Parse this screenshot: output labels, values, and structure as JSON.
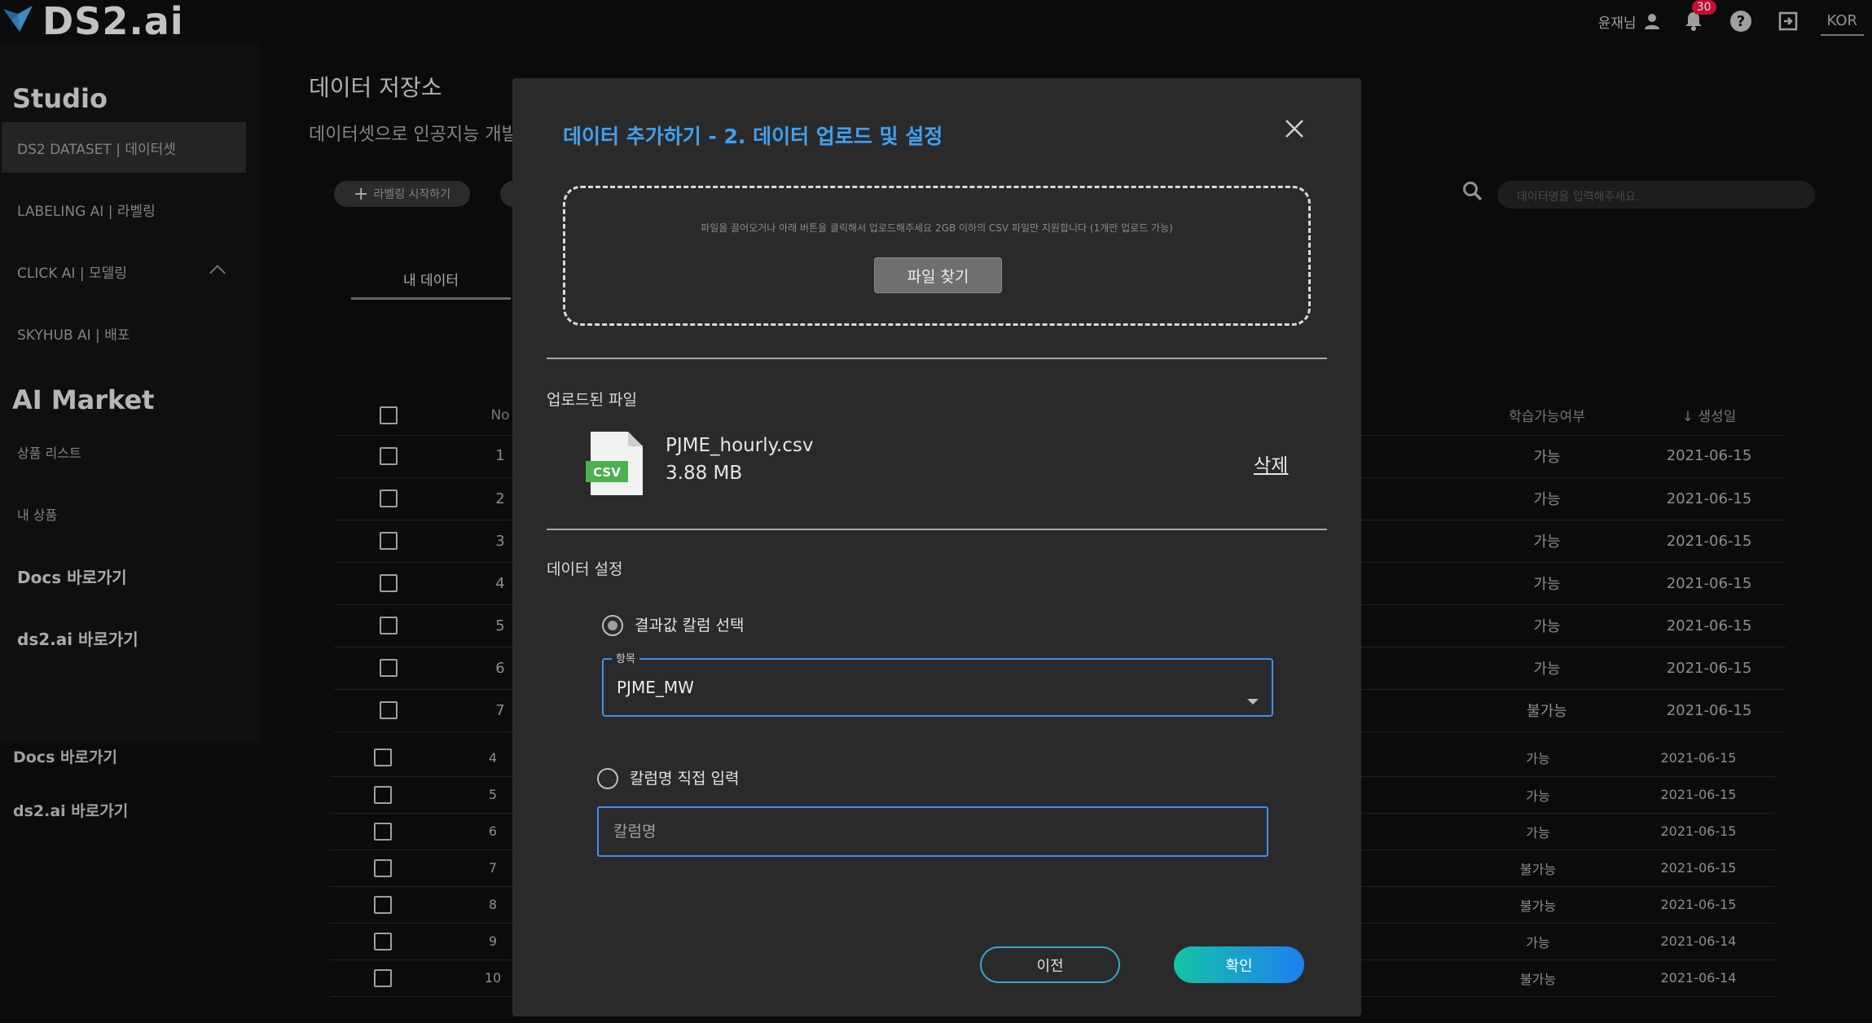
{
  "app": {
    "logo_text": "DS2.ai"
  },
  "topbar": {
    "user_name": "윤재님",
    "notification_count": "30",
    "language": "KOR"
  },
  "sidebar": {
    "studio_title": "Studio",
    "items": [
      {
        "label": "DS2 DATASET | 데이터셋"
      },
      {
        "label": "LABELING AI | 라벨링"
      },
      {
        "label": "CLICK AI | 모델링"
      },
      {
        "label": "SKYHUB AI | 배포"
      }
    ],
    "market_title": "AI Market",
    "market_items": [
      {
        "label": "상품 리스트"
      },
      {
        "label": "내 상품"
      }
    ],
    "links": [
      {
        "label": "Docs 바로가기"
      },
      {
        "label": "ds2.ai 바로가기"
      }
    ],
    "bottom_links": [
      {
        "label": "Docs 바로가기"
      },
      {
        "label": "ds2.ai 바로가기"
      }
    ]
  },
  "page": {
    "title": "데이터 저장소",
    "description": "데이터셋으로 인공지능 개발",
    "start_labeling_button": "라벨링 시작하기",
    "tab_my_data": "내 데이터",
    "search_placeholder": "데이터명을 입력해주세요."
  },
  "table": {
    "headers": {
      "no": "No",
      "trainable": "학습가능여부",
      "created": "생성일"
    },
    "rows_top": [
      {
        "no": "1",
        "trainable": "가능",
        "created": "2021-06-15"
      },
      {
        "no": "2",
        "trainable": "가능",
        "created": "2021-06-15"
      },
      {
        "no": "3",
        "trainable": "가능",
        "created": "2021-06-15"
      },
      {
        "no": "4",
        "trainable": "가능",
        "created": "2021-06-15"
      },
      {
        "no": "5",
        "trainable": "가능",
        "created": "2021-06-15"
      },
      {
        "no": "6",
        "trainable": "가능",
        "created": "2021-06-15"
      },
      {
        "no": "7",
        "trainable": "불가능",
        "created": "2021-06-15"
      }
    ],
    "rows_bottom": [
      {
        "no": "4",
        "trainable": "가능",
        "created": "2021-06-15"
      },
      {
        "no": "5",
        "trainable": "가능",
        "created": "2021-06-15"
      },
      {
        "no": "6",
        "trainable": "가능",
        "created": "2021-06-15"
      },
      {
        "no": "7",
        "trainable": "불가능",
        "created": "2021-06-15"
      },
      {
        "no": "8",
        "trainable": "불가능",
        "created": "2021-06-15"
      },
      {
        "no": "9",
        "trainable": "가능",
        "created": "2021-06-14"
      },
      {
        "no": "10",
        "trainable": "불가능",
        "created": "2021-06-14"
      }
    ]
  },
  "modal": {
    "title": "데이터 추가하기 - 2. 데이터 업로드 및 설정",
    "upload_hint": "파일을 끌어오거나 아래 버튼을 클릭해서 업로드해주세요 2GB 이하의 CSV 파일만 지원합니다 (1개만 업로드 가능)",
    "find_file_button": "파일 찾기",
    "uploaded_section": "업로드된 파일",
    "file": {
      "type_badge": "CSV",
      "name": "PJME_hourly.csv",
      "size": "3.88 MB",
      "delete_label": "삭제"
    },
    "settings_section": "데이터 설정",
    "option_select_label": "결과값 칼럼 선택",
    "select_legend": "항목",
    "select_value": "PJME_MW",
    "option_input_label": "칼럼명 직접 입력",
    "column_input_placeholder": "칼럼명",
    "column_input_value": "",
    "prev_button": "이전",
    "confirm_button": "확인"
  },
  "colors": {
    "accent_blue": "#3fa1f0",
    "focus_border": "#3f8ff0",
    "confirm_gradient_start": "#14c3a6",
    "confirm_gradient_end": "#1e7ff2",
    "csv_green": "#4caf50",
    "badge_red": "#e0153d"
  }
}
